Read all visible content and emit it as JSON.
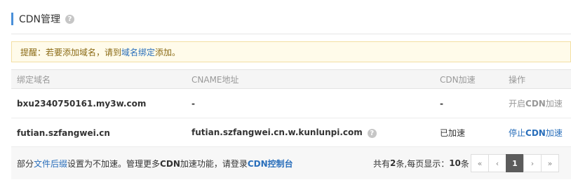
{
  "header": {
    "title": "CDN管理",
    "help_icon": "question-circle-icon"
  },
  "alert": {
    "prefix": "提醒：若要添加域名，请到",
    "link": "域名绑定",
    "suffix": "添加。"
  },
  "table": {
    "columns": [
      "绑定域名",
      "CNAME地址",
      "CDN加速",
      "操作"
    ],
    "rows": [
      {
        "domain": "bxu2340750161.my3w.com",
        "cname": "-",
        "cdn": "-",
        "action_prefix": "开启",
        "action_bold": "CDN",
        "action_suffix": "加速"
      },
      {
        "domain": "futian.szfangwei.cn",
        "cname": "futian.szfangwei.cn.w.kunlunpi.com",
        "cdn": "已加速",
        "action_prefix": "停止",
        "action_bold": "CDN",
        "action_suffix": "加速"
      }
    ]
  },
  "footer": {
    "note_a": "部分",
    "note_link": "文件后缀",
    "note_b": "设置为不加速。管理更多",
    "note_bold": "CDN",
    "note_c": "加速功能，请登录",
    "note_link2": "CDN控制台"
  },
  "pagination": {
    "info_a": "共有",
    "total": "2",
    "info_b": "条,每页显示：",
    "per_page": "10",
    "info_c": "条",
    "first": "«",
    "prev": "‹",
    "current": "1",
    "next": "›",
    "last": "»"
  }
}
